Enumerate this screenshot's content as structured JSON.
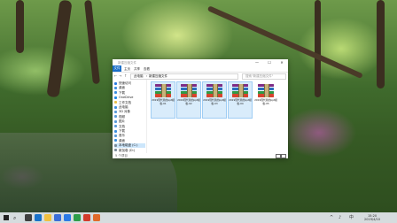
{
  "window": {
    "title": "新建压缩文件",
    "ribbon_tabs": [
      "文件",
      "主页",
      "共享",
      "查看"
    ],
    "controls": {
      "minimize": "—",
      "maximize": "☐",
      "close": "✕"
    },
    "nav_buttons": [
      "←",
      "→",
      "↑"
    ],
    "address": {
      "segments": [
        "此电脑",
        "新建压缩文件"
      ],
      "separator": "›"
    },
    "search_placeholder": "搜索\"新建压缩文件\"",
    "nav_pane": [
      {
        "label": "快速访问",
        "icon": "star-icon",
        "color": "#2b7be0"
      },
      {
        "label": "桌面",
        "icon": "desktop-folder-icon",
        "color": "#3b8fe0"
      },
      {
        "label": "下载",
        "icon": "download-folder-icon",
        "color": "#3b8fe0"
      },
      {
        "label": "OneDrive",
        "icon": "cloud-icon",
        "color": "#1e88e5"
      },
      {
        "label": "工作文档",
        "icon": "folder-icon",
        "color": "#e8c04a"
      },
      {
        "label": "此电脑",
        "icon": "computer-icon",
        "color": "#3b8fe0"
      },
      {
        "label": "3D 对象",
        "icon": "cube-folder-icon",
        "color": "#5a9bd8"
      },
      {
        "label": "视频",
        "icon": "video-folder-icon",
        "color": "#5a9bd8"
      },
      {
        "label": "图片",
        "icon": "picture-folder-icon",
        "color": "#5a9bd8"
      },
      {
        "label": "文档",
        "icon": "document-folder-icon",
        "color": "#5a9bd8"
      },
      {
        "label": "下载",
        "icon": "download-folder-icon",
        "color": "#3b8fe0"
      },
      {
        "label": "音乐",
        "icon": "music-folder-icon",
        "color": "#5a9bd8"
      },
      {
        "label": "桌面",
        "icon": "desktop-folder-icon",
        "color": "#3b8fe0"
      },
      {
        "label": "本地磁盘 (C:)",
        "icon": "drive-icon",
        "color": "#7a8a9a"
      },
      {
        "label": "新加卷 (D:)",
        "icon": "drive-icon",
        "color": "#7a8a9a"
      }
    ],
    "files": [
      {
        "name": "2019现代简约ppt模板-01"
      },
      {
        "name": "2019现代简约ppt模板-02"
      },
      {
        "name": "2019现代简约ppt模板-03"
      },
      {
        "name": "2019现代简约ppt模板-04"
      },
      {
        "name": "2019现代简约ppt模板-05"
      }
    ],
    "status": "5 个项目"
  },
  "taskbar": {
    "search_glyph": "⌕",
    "apps": [
      {
        "name": "task-view",
        "color": "#404040"
      },
      {
        "name": "edge",
        "color": "#1a73c9"
      },
      {
        "name": "explorer",
        "color": "#f0c040"
      },
      {
        "name": "store",
        "color": "#3a6ed8"
      },
      {
        "name": "mail",
        "color": "#2c7be5"
      },
      {
        "name": "app-green",
        "color": "#2e9e4a"
      },
      {
        "name": "app-red",
        "color": "#d33b2c"
      },
      {
        "name": "app-orange",
        "color": "#e06a2a"
      }
    ],
    "tray_glyphs": [
      "^",
      "♪",
      "中"
    ],
    "clock": {
      "time": "15:20",
      "date": "2019/4/10"
    }
  },
  "colors": {
    "accent": "#1a6fc9",
    "rar_stack": [
      "#7e2c86",
      "#2c6fbf",
      "#2f9a45",
      "#d7442e"
    ]
  }
}
